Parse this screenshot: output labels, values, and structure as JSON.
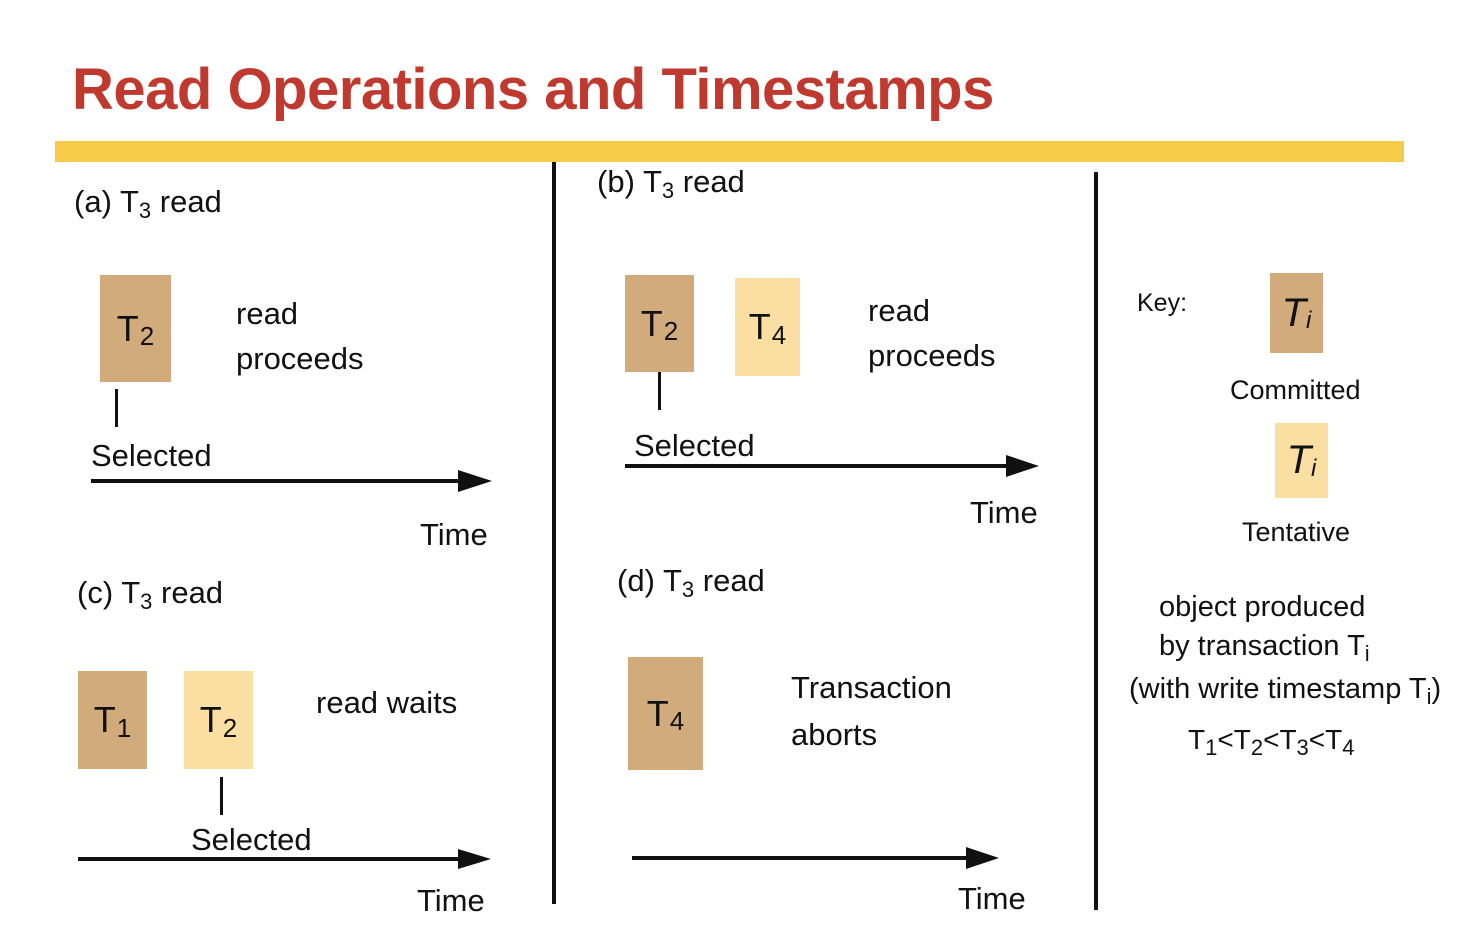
{
  "title": "Read Operations and Timestamps",
  "panels": {
    "a": {
      "caption_prefix": "(a) T",
      "caption_sub": "3",
      "caption_suffix": " read",
      "boxes": [
        {
          "letter": "T",
          "sub": "2",
          "status": "committed"
        }
      ],
      "result_line1": "read",
      "result_line2": "proceeds",
      "selected": "Selected",
      "time": "Time"
    },
    "b": {
      "caption_prefix": "(b) T",
      "caption_sub": "3",
      "caption_suffix": " read",
      "boxes": [
        {
          "letter": "T",
          "sub": "2",
          "status": "committed"
        },
        {
          "letter": "T",
          "sub": "4",
          "status": "tentative"
        }
      ],
      "result_line1": "read",
      "result_line2": "proceeds",
      "selected": "Selected",
      "time": "Time"
    },
    "c": {
      "caption_prefix": "(c) T",
      "caption_sub": "3",
      "caption_suffix": " read",
      "boxes": [
        {
          "letter": "T",
          "sub": "1",
          "status": "committed"
        },
        {
          "letter": "T",
          "sub": "2",
          "status": "tentative"
        }
      ],
      "result_line1": "read waits",
      "selected": "Selected",
      "time": "Time"
    },
    "d": {
      "caption_prefix": "(d) T",
      "caption_sub": "3",
      "caption_suffix": " read",
      "boxes": [
        {
          "letter": "T",
          "sub": "4",
          "status": "committed"
        }
      ],
      "result_line1": "Transaction",
      "result_line2": "aborts",
      "time": "Time"
    }
  },
  "key": {
    "label": "Key:",
    "symbol_letter": "T",
    "symbol_sub": "i",
    "committed": "Committed",
    "tentative": "Tentative",
    "desc_line1": "object produced",
    "desc_line2_prefix": "by transaction T",
    "desc_line2_sub": "i",
    "desc_line3_prefix": "(with write timestamp T",
    "desc_line3_sub": "i",
    "desc_line3_suffix": ")",
    "order": [
      {
        "t": "T",
        "sub": "1",
        "sep": "<"
      },
      {
        "t": "T",
        "sub": "2",
        "sep": "<"
      },
      {
        "t": "T",
        "sub": "3",
        "sep": "<"
      },
      {
        "t": "T",
        "sub": "4",
        "sep": ""
      }
    ]
  },
  "colors": {
    "title": "#c0392f",
    "accent_bar": "#f5cb47",
    "committed": "#d1ab7b",
    "tentative": "#fbdfa2"
  }
}
